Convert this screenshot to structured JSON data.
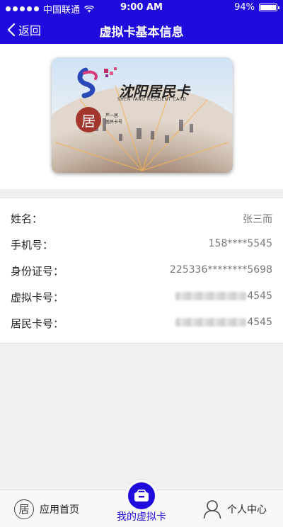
{
  "status_bar": {
    "carrier": "中国联通",
    "time": "9:00 AM",
    "battery": "94%"
  },
  "nav": {
    "back_label": "返回",
    "title": "虚拟卡基本信息"
  },
  "card": {
    "title": "沈阳居民卡",
    "subtitle": "SHEN YANG RESIDENT CARD",
    "seal_char": "居",
    "small_lines": [
      "芦一居",
      "居民卡号"
    ]
  },
  "info_rows": [
    {
      "label": "姓名：",
      "value": "张三而",
      "masked": false
    },
    {
      "label": "手机号：",
      "value": "158****5545",
      "masked": false
    },
    {
      "label": "身份证号：",
      "value": "225336********5698",
      "masked": false
    },
    {
      "label": "虚拟卡号：",
      "value": "4545",
      "masked": true
    },
    {
      "label": "居民卡号：",
      "value": "4545",
      "masked": true
    }
  ],
  "tabbar": {
    "home": {
      "label": "应用首页",
      "icon": "resident-seal-icon",
      "icon_char": "居"
    },
    "center": {
      "label": "我的虚拟卡",
      "icon": "card-wallet-icon",
      "active": true
    },
    "profile": {
      "label": "个人中心",
      "icon": "person-icon"
    }
  },
  "colors": {
    "brand": "#1f0bdc",
    "seal": "#a3362d",
    "background": "#f0f0f2"
  }
}
